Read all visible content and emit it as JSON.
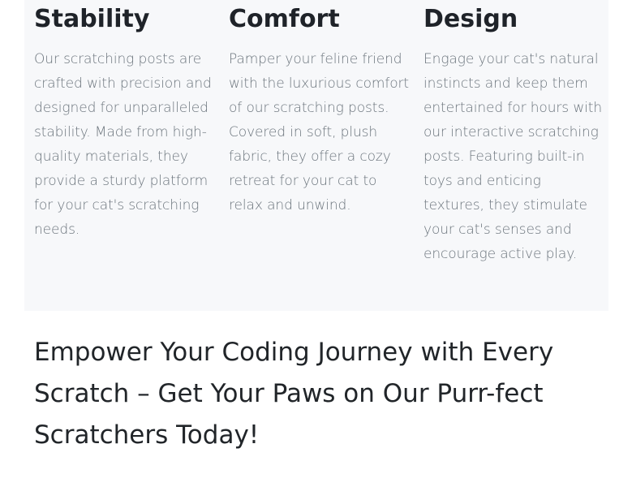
{
  "features": [
    {
      "title": "Stability",
      "text": "Our scratching posts are crafted with precision and designed for unparalleled stability. Made from high-quality materials, they provide a sturdy platform for your cat's scratching needs."
    },
    {
      "title": "Comfort",
      "text": "Pamper your feline friend with the luxurious comfort of our scratching posts. Covered in soft, plush fabric, they offer a cozy retreat for your cat to relax and unwind."
    },
    {
      "title": "Design",
      "text": "Engage your cat's natural instincts and keep them entertained for hours with our interactive scratching posts. Featuring built-in toys and enticing textures, they stimulate your cat's senses and encourage active play."
    }
  ],
  "cta": {
    "heading": "Empower Your Coding Journey with Every Scratch – Get Your Paws on Our Purr-fect Scratchers Today!"
  }
}
